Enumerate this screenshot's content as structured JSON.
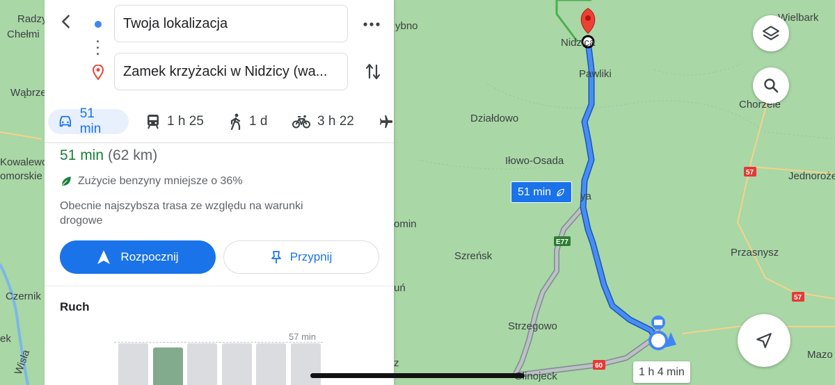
{
  "panel": {
    "origin_field": "Twoja lokalizacja",
    "destination_field": "Zamek krzyżacki w Nidzicy (wa...",
    "modes": [
      {
        "name": "car",
        "label": "51 min"
      },
      {
        "name": "transit",
        "label": "1 h 25"
      },
      {
        "name": "walk",
        "label": "1 d"
      },
      {
        "name": "bike",
        "label": "3 h 22"
      }
    ],
    "route": {
      "duration": "51 min",
      "distance": "(62 km)",
      "eco_note": "Zużycie benzyny mniejsze o 36%",
      "description": "Obecnie najszybsza trasa ze względu na warunki drogowe"
    },
    "start_button": "Rozpocznij",
    "pin_button": "Przypnij",
    "traffic": {
      "title": "Ruch",
      "max_label": "57 min"
    }
  },
  "map": {
    "places": {
      "nidzica": "Nidzica",
      "pawliki": "Pawliki",
      "dzialdowo": "Działdowo",
      "ilowo": "Iłowo-Osada",
      "szrensk": "Szreńsk",
      "strzegowo": "Strzegowo",
      "glinojeck": "Glinojeck",
      "przasnysz": "Przasnysz",
      "chorzele": "Chorzele",
      "wielbark": "Wielbark",
      "jednoroz": "Jednoroże",
      "mazo": "Mazo",
      "radzyn": "Radzy",
      "chelmno": "Chełmi",
      "wabrzezno": "Wąbrzez",
      "kowalewo": "Kowalewo",
      "pomorskie": "omorskie",
      "czernik": "Czernik",
      "wisla": "Wisła",
      "zybno": "ybno",
      "omin": "omin",
      "un": "uń",
      "ya": "ya",
      "ek": "ek",
      "z": "z"
    },
    "road_shields": {
      "e77": "E77",
      "r57a": "57",
      "r57b": "57",
      "r60": "60"
    },
    "primary_route_label": "51 min",
    "alternate_route_label": "1 h 4 min"
  },
  "colors": {
    "map_bg": "#a9d7a6",
    "route_primary": "#1a73e8",
    "route_alt": "#9aa0a6",
    "accent": "#1a73e8",
    "eco_green": "#188038",
    "pin_red": "#ea4335"
  }
}
